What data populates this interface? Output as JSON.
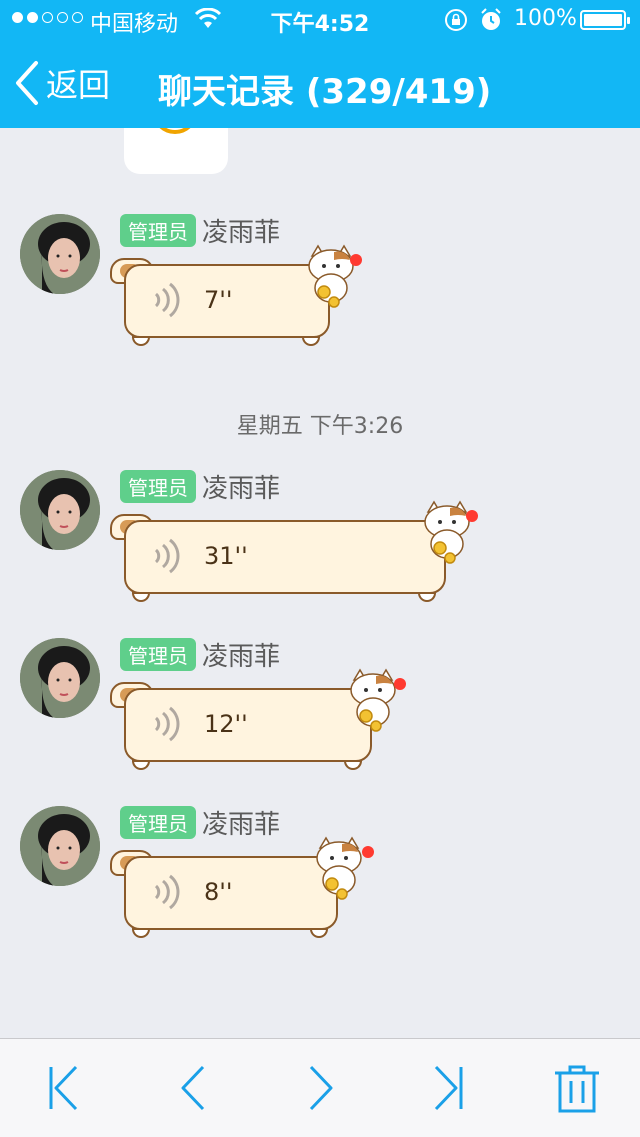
{
  "status_bar": {
    "carrier": "中国移动",
    "time": "下午4:52",
    "battery": "100%"
  },
  "nav": {
    "back_label": "返回",
    "title": "聊天记录 (329/419)"
  },
  "messages": [
    {
      "badge": "管理员",
      "sender": "凌雨菲",
      "duration": "7''"
    },
    {
      "badge": "管理员",
      "sender": "凌雨菲",
      "duration": "31''"
    },
    {
      "badge": "管理员",
      "sender": "凌雨菲",
      "duration": "12''"
    },
    {
      "badge": "管理员",
      "sender": "凌雨菲",
      "duration": "8''"
    }
  ],
  "timestamp": "星期五 下午3:26",
  "colors": {
    "header": "#12b7f5",
    "background": "#ebedf2",
    "badge": "#5fcf8b",
    "bubble": "#fff4df",
    "unread_dot": "#ff3a30",
    "toolbar_icon": "#1aa0e8"
  },
  "toolbar_icons": [
    "first-page-icon",
    "previous-icon",
    "next-icon",
    "last-page-icon",
    "trash-icon"
  ]
}
